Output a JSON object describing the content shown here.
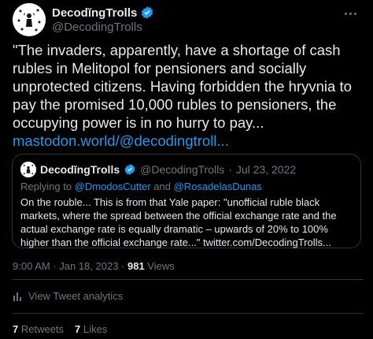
{
  "author": {
    "display_name": "Decodĭng​Trolls",
    "handle": "@DecodingTrolls"
  },
  "tweet": {
    "text": "\"The invaders, apparently, have a shortage of cash rubles in Melitopol for pensioners and socially unprotected citizens. Having forbidden the hryvnia to pay the promised 10,000 rubles to pensioners, the occupying power is in no hurry to pay...",
    "link": "mastodon.world/@decodingtroll..."
  },
  "quote": {
    "display_name": "Decodĭng​Trolls",
    "handle": "@DecodingTrolls",
    "separator": "·",
    "date": "Jul 23, 2022",
    "replying_prefix": "Replying to ",
    "replying_to_1": "@DmodosCutter",
    "replying_and": " and ",
    "replying_to_2": "@RosadelasDunas",
    "text": "On the rouble... This is from that Yale paper: \"unofficial ruble black markets, where the spread between the official exchange rate and the actual exchange rate is equally dramatic – upwards of 20% to 100% higher than the official exchange rate...\" twitter.com/DecodingTrolls..."
  },
  "meta": {
    "time": "9:00 AM · Jan 18, 2023 · ",
    "views_count": "981",
    "views_label": " Views"
  },
  "analytics": {
    "label": "View Tweet analytics",
    "icon": "bar-chart-icon"
  },
  "stats": {
    "retweets_count": "7",
    "retweets_label": " Retweets",
    "likes_count": "7",
    "likes_label": " Likes"
  },
  "colors": {
    "background": "#000000",
    "text": "#e7e9ea",
    "secondary": "#71767b",
    "accent": "#1d9bf0",
    "border": "#2f3336"
  }
}
